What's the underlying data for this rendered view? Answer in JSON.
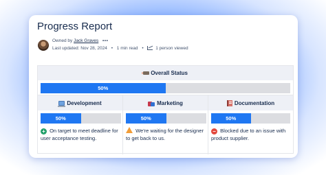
{
  "page": {
    "title": "Progress Report",
    "owner_prefix": "Owned by",
    "owner_name": "Jack Graves",
    "more_label": "•••",
    "last_updated": "Last updated: Nov 28, 2024",
    "read_time": "1 min read",
    "viewers": "1 person viewed"
  },
  "overall": {
    "heading": "Overall Status",
    "icon": "pencil-icon",
    "progress_label": "50%",
    "progress": 0.5
  },
  "columns": [
    {
      "heading": "Development",
      "icon": "laptop-icon",
      "progress_label": "50%",
      "progress": 0.5,
      "status_icon": "success-plus-icon",
      "status_color": "#22a06b",
      "note": "On target to meet deadline for user acceptance testing."
    },
    {
      "heading": "Marketing",
      "icon": "shopping-bags-icon",
      "progress_label": "50%",
      "progress": 0.5,
      "status_icon": "warning-icon",
      "status_color": "#f29d38",
      "note": "We're waiting for the designer to get back to us."
    },
    {
      "heading": "Documentation",
      "icon": "book-icon",
      "progress_label": "50%",
      "progress": 0.5,
      "status_icon": "blocked-icon",
      "status_color": "#e2483d",
      "note": "Blocked due to an issue with product supplier."
    }
  ],
  "colors": {
    "progress_fill": "#1f77f2",
    "progress_track": "#dcdde1",
    "header_bg": "#eef0f6"
  }
}
